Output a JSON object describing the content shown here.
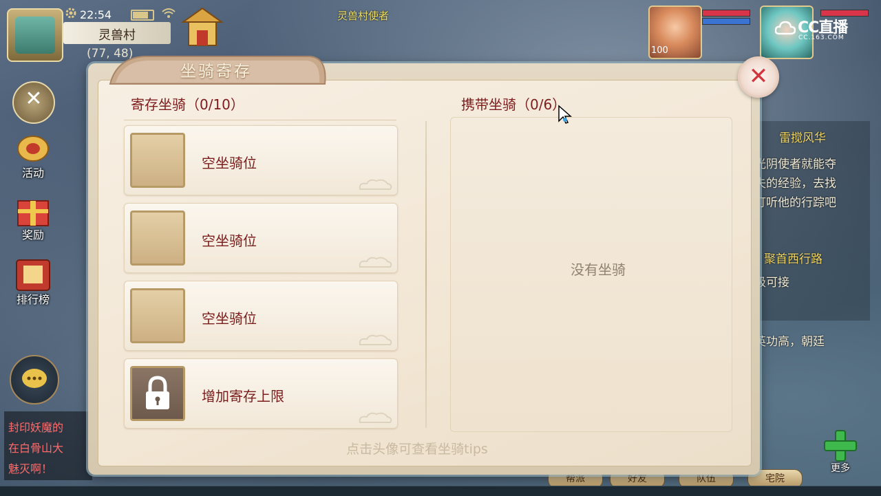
{
  "hud": {
    "time": "22:54",
    "location_name": "灵兽村",
    "coordinates": "(77, 48)",
    "npc_label": "灵兽村使者",
    "pet_level": "100",
    "watermark_main": "CC直播",
    "watermark_sub": "CC.163.COM"
  },
  "left_menu": [
    {
      "label": "活动",
      "icon": "activity-icon"
    },
    {
      "label": "奖励",
      "icon": "gift-icon"
    },
    {
      "label": "排行榜",
      "icon": "leaderboard-icon"
    }
  ],
  "chat": {
    "lines": [
      "封印妖魔的",
      "在白骨山大",
      "魅灭啊！"
    ]
  },
  "quest_panel": {
    "title": "雷搅风华",
    "lines": [
      "光阴使者就能夺",
      "失的经验，去找",
      "打听他的行踪吧",
      "聚首西行路",
      "级可接",
      "英功高，朝廷"
    ]
  },
  "bottom_buttons": [
    "帮派",
    "好友",
    "队伍",
    "宅院",
    "更多"
  ],
  "dialog": {
    "title": "坐骑寄存",
    "stored_header": "寄存坐骑（0/10）",
    "carry_header": "携带坐骑（0/6）",
    "slots": [
      {
        "label": "空坐骑位",
        "locked": false
      },
      {
        "label": "空坐骑位",
        "locked": false
      },
      {
        "label": "空坐骑位",
        "locked": false
      },
      {
        "label": "增加寄存上限",
        "locked": true
      }
    ],
    "empty_carry_text": "没有坐骑",
    "hint": "点击头像可查看坐骑tips",
    "close_symbol": "✕"
  },
  "colors": {
    "accent_text": "#7d1c1c",
    "close_red": "#d1353e",
    "panel_bg": "#f2e6d4"
  }
}
